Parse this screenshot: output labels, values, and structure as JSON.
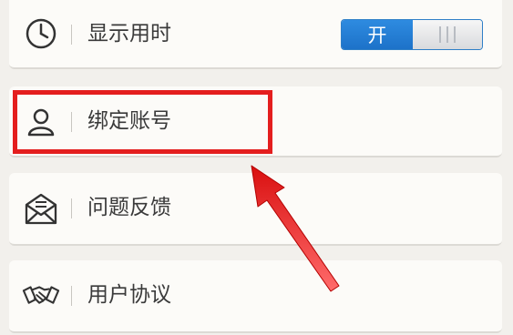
{
  "settings": {
    "items": [
      {
        "label": "显示用时",
        "icon": "clock-icon"
      },
      {
        "label": "绑定账号",
        "icon": "user-icon"
      },
      {
        "label": "问题反馈",
        "icon": "mail-icon"
      },
      {
        "label": "用户协议",
        "icon": "handshake-icon"
      }
    ],
    "toggle": {
      "on_label": "开",
      "state": "on"
    }
  },
  "annotation": {
    "color": "#e41e1e",
    "target": "绑定账号"
  },
  "colors": {
    "accent": "#2e8be0",
    "background": "#f2f0ec",
    "card": "#fcfbf8"
  }
}
